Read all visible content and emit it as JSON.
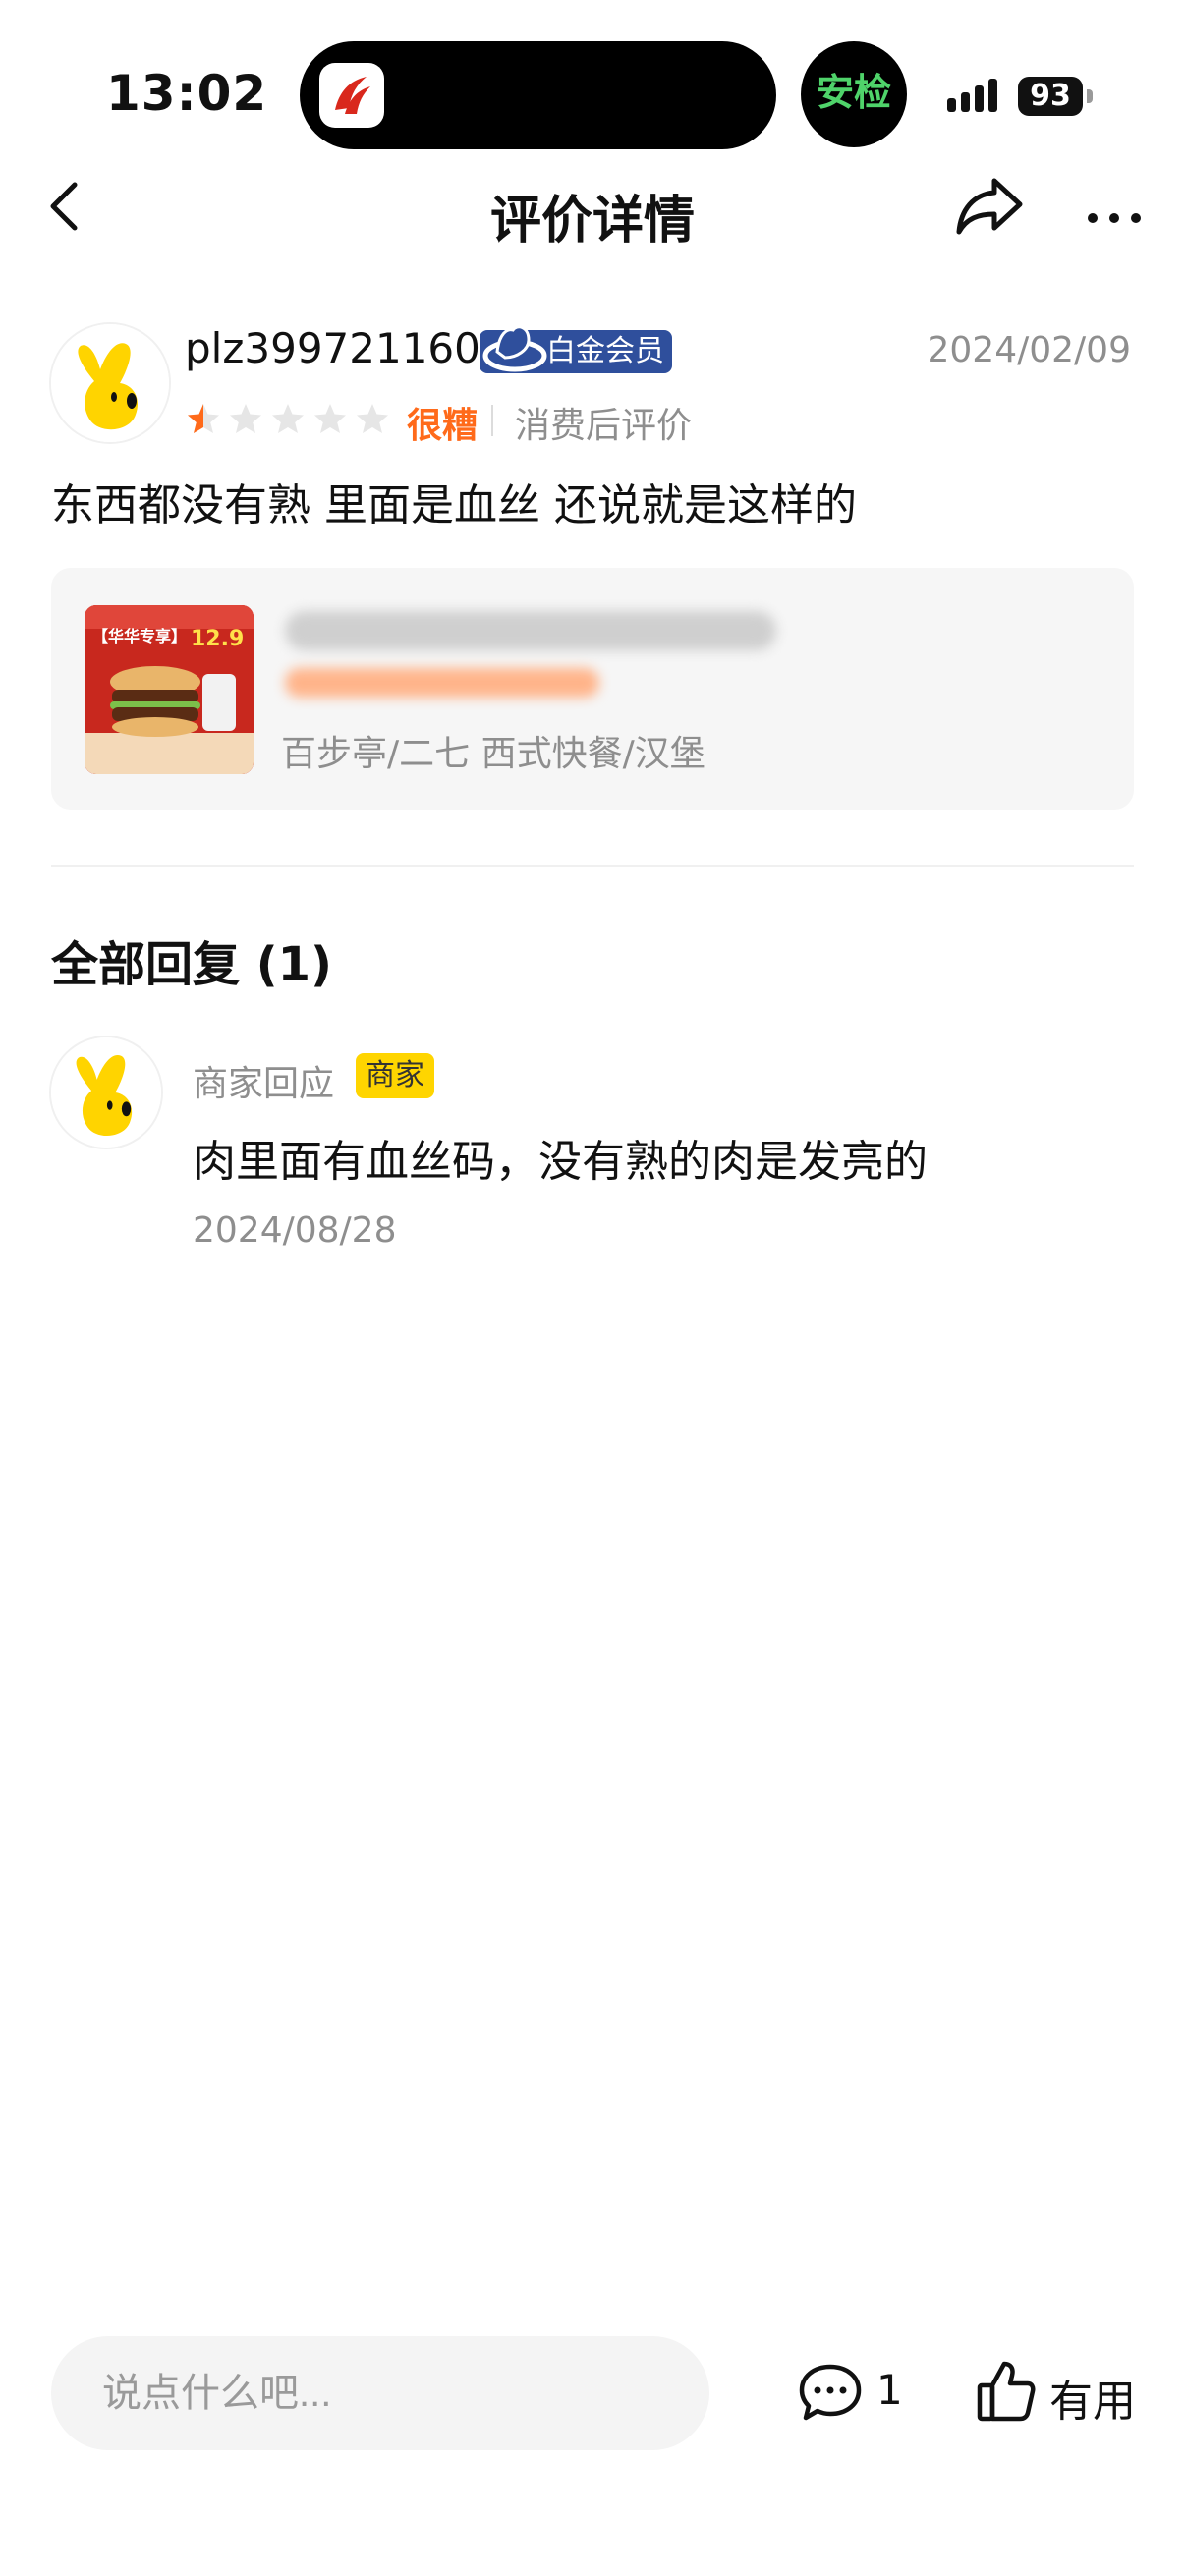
{
  "status_bar": {
    "time": "13:02",
    "battery": "93",
    "anjian_label": "安检"
  },
  "nav": {
    "title": "评价详情"
  },
  "review": {
    "username": "plz399721160",
    "member_badge": "白金会员",
    "date": "2024/02/09",
    "rating_stars": 0.5,
    "rating_max": 5,
    "rating_text": "很糟",
    "rating_note": "消费后评价",
    "text": "东西都没有熟 里面是血丝 还说就是这样的"
  },
  "shop": {
    "thumb_tag": "【华华专享】",
    "thumb_price": "12.9",
    "location": "百步亭/二七 西式快餐/汉堡"
  },
  "replies": {
    "title": "全部回复 (1)",
    "items": [
      {
        "name": "商家回应",
        "badge": "商家",
        "text": "肉里面有血丝码，没有熟的肉是发亮的",
        "date": "2024/08/28"
      }
    ]
  },
  "bottom_bar": {
    "input_placeholder": "说点什么吧...",
    "comment_count": "1",
    "useful_label": "有用"
  },
  "colors": {
    "accent_orange": "#ff6a1a",
    "member_blue": "#2f4f9c",
    "merchant_yellow": "#ffd500",
    "muted_text": "#8e8e8e"
  }
}
